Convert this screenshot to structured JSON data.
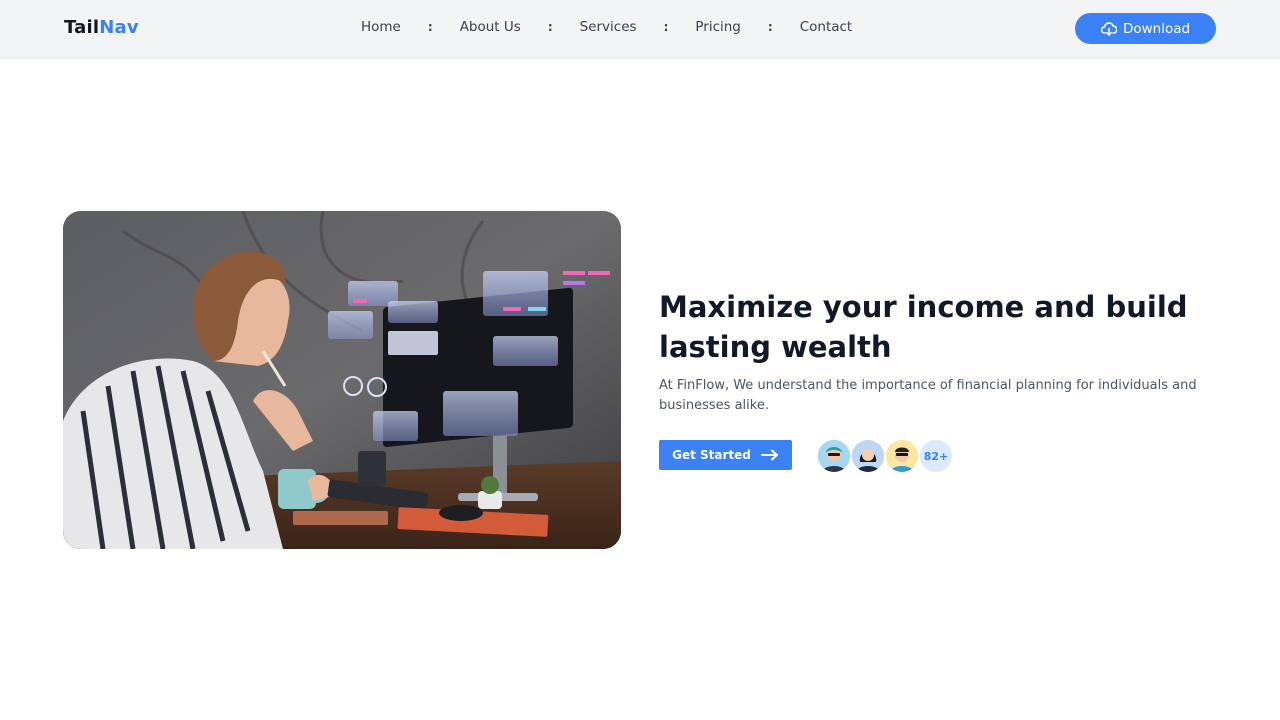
{
  "brand": {
    "part1": "Tail",
    "part2": "Nav"
  },
  "nav": {
    "items": [
      {
        "label": "Home"
      },
      {
        "label": "About Us"
      },
      {
        "label": "Services"
      },
      {
        "label": "Pricing"
      },
      {
        "label": "Contact"
      }
    ],
    "separator": ":"
  },
  "download": {
    "label": "Download",
    "icon": "cloud-download-icon"
  },
  "hero": {
    "headline": "Maximize your income and build lasting wealth",
    "subtext": "At FinFlow, We understand the importance of financial planning for individuals and businesses alike.",
    "cta_label": "Get Started",
    "cta_icon": "arrow-right-icon",
    "avatar_count": "82+"
  },
  "colors": {
    "accent": "#3b82f6",
    "nav_bg": "#f3f4f6",
    "text": "#111827"
  }
}
